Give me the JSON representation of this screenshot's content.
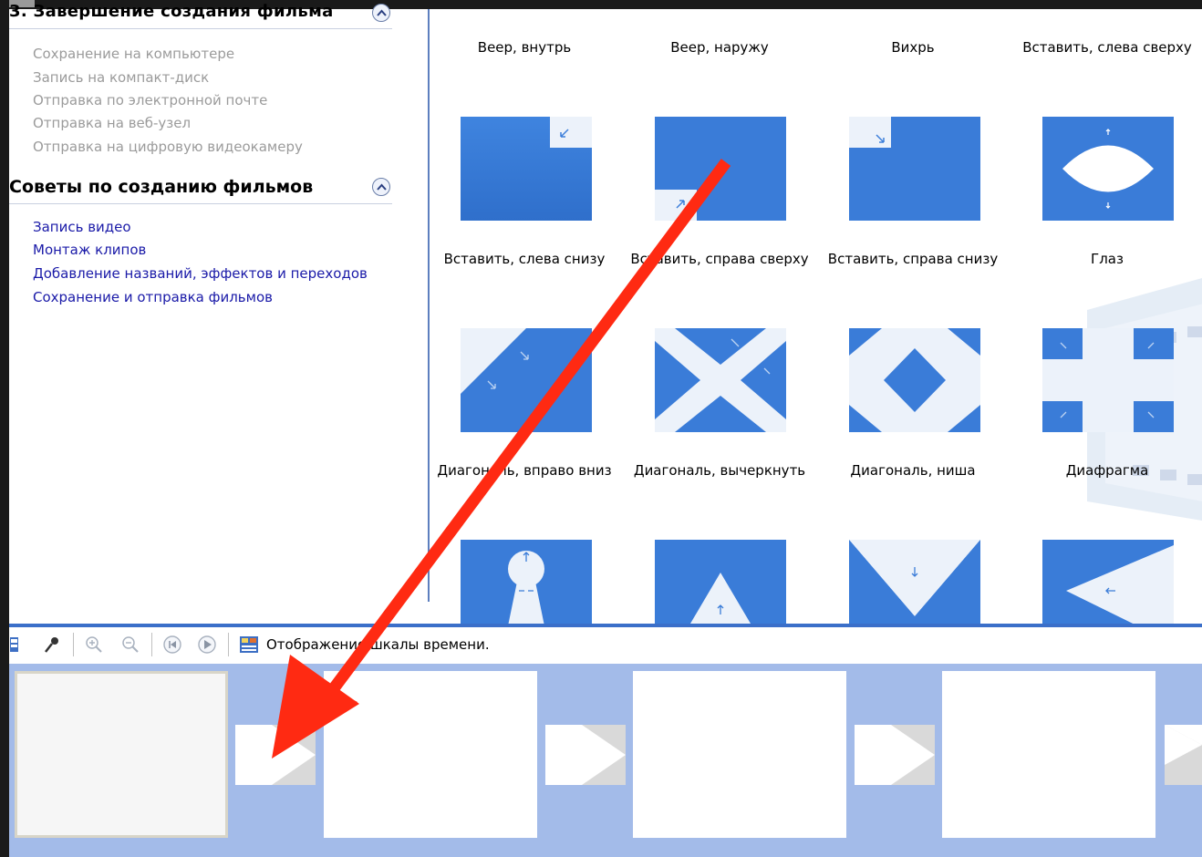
{
  "tasks": {
    "section3_title": "3. Завершение создания фильма",
    "section3_items": [
      "Сохранение на компьютере",
      "Запись на компакт-диск",
      "Отправка по электронной почте",
      "Отправка на веб-узел",
      "Отправка на цифровую видеокамеру"
    ],
    "tips_title": "Советы по созданию фильмов",
    "tips_items": [
      "Запись видео",
      "Монтаж клипов",
      "Добавление названий, эффектов и переходов",
      "Сохранение и отправка фильмов"
    ]
  },
  "transitions": {
    "row0_labels": [
      "Веер, внутрь",
      "Веер, наружу",
      "Вихрь",
      "Вставить, слева сверху"
    ],
    "row1_labels": [
      "Вставить, слева снизу",
      "Вставить, справа сверху",
      "Вставить, справа снизу",
      "Глаз"
    ],
    "row2_labels": [
      "Диагональ, вправо вниз",
      "Диагональ, вычеркнуть",
      "Диагональ, ниша",
      "Диафрагма"
    ]
  },
  "timeline": {
    "toggle_label": "Отображение шкалы времени."
  },
  "colors": {
    "accent": "#3b6fc9",
    "tile_blue": "#3d7fda",
    "storyboard_bg": "#a3bbe9",
    "arrow_red": "#ff2a12"
  }
}
